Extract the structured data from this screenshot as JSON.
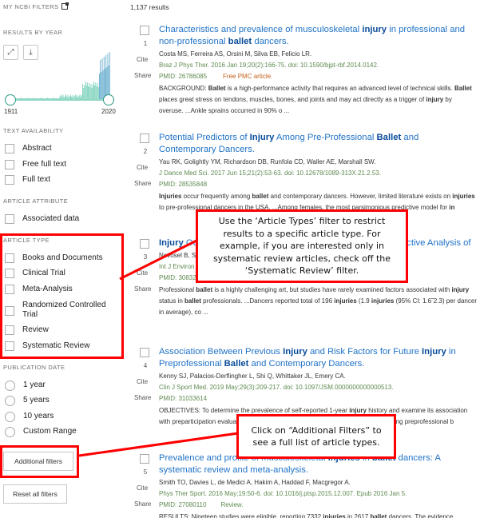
{
  "sidebar": {
    "my_ncbi_filters": "MY NCBI FILTERS",
    "my_ncbi_icon": "external-link-icon",
    "results_by_year": {
      "heading": "RESULTS BY YEAR",
      "expand_icon": "expand-icon",
      "download_icon": "download-icon",
      "year_start": "1911",
      "year_end": "2020",
      "bar_color": "#7fd3bd",
      "bar_color_recent": "#6aafd0"
    },
    "text_availability": {
      "heading": "TEXT AVAILABILITY",
      "items": [
        {
          "label": "Abstract",
          "checked": false
        },
        {
          "label": "Free full text",
          "checked": false
        },
        {
          "label": "Full text",
          "checked": false
        }
      ]
    },
    "article_attribute": {
      "heading": "ARTICLE ATTRIBUTE",
      "items": [
        {
          "label": "Associated data",
          "checked": false
        }
      ]
    },
    "article_type": {
      "heading": "ARTICLE TYPE",
      "items": [
        {
          "label": "Books and Documents",
          "checked": false
        },
        {
          "label": "Clinical Trial",
          "checked": false
        },
        {
          "label": "Meta-Analysis",
          "checked": false
        },
        {
          "label": "Randomized Controlled Trial",
          "checked": false
        },
        {
          "label": "Review",
          "checked": false
        },
        {
          "label": "Systematic Review",
          "checked": false
        }
      ]
    },
    "publication_date": {
      "heading": "PUBLICATION DATE",
      "items": [
        {
          "label": "1 year",
          "selected": false
        },
        {
          "label": "5 years",
          "selected": false
        },
        {
          "label": "10 years",
          "selected": false
        },
        {
          "label": "Custom Range",
          "selected": false
        }
      ]
    },
    "additional_filters_label": "Additional filters",
    "reset_filters_label": "Reset all filters"
  },
  "results": {
    "count": "1,137 results",
    "cite_label": "Cite",
    "share_label": "Share",
    "items": [
      {
        "number": "1",
        "title_html": "Characteristics and prevalence of musculoskeletal <b>injury</b> in professional and non-professional <b>ballet</b> dancers.",
        "authors": "Costa MS, Ferreira AS, Orsini M, Silva EB, Felicio LR.",
        "journal": "Braz J Phys Ther. 2016 Jan 19;20(2):166-75. doi: 10.1590/bjpt-rbf.2014.0142.",
        "pmid": "PMID: 26786085",
        "badge": "Free PMC article.",
        "snippet_html": "BACKGROUND: <b>Ballet</b> is a high-performance activity that requires an advanced level of technical skills. <b>Ballet</b> places great stress on tendons, muscles, bones, and joints and may act directly as a trigger of <b>injury</b> by overuse. ...Ankle sprains occurred in 90% o ..."
      },
      {
        "number": "2",
        "title_html": "Potential Predictors of <b>Injury</b> Among Pre-Professional <b>Ballet</b> and Contemporary Dancers.",
        "authors": "Yau RK, Golightly YM, Richardson DB, Runfola CD, Waller AE, Marshall SW.",
        "journal": "J Dance Med Sci. 2017 Jun 15;21(2):53-63. doi: 10.12678/1089-313X.21.2.53.",
        "pmid": "PMID: 28535848",
        "badge": "",
        "snippet_html": "<b>Injuries</b> occur frequently among <b>ballet</b> and contemporary dancers. However, limited literature exists on <b>injuries</b> to pre-professional dancers in the USA. ...Among females, the most parsimonious predictive model for <b>in</b>"
      },
      {
        "number": "3",
        "title_html": "<b>Injury</b> Occurrence in Professional <b>Ballet</b> Dancers: A Retrospective Analysis of",
        "authors": "Novosel B, S",
        "journal": "Int J Environ",
        "pmid": "PMID: 30832431",
        "badge": "Free PMC article.",
        "snippet_html": "Professional <b>ballet</b> is a highly challenging art, but studies have rarely examined factors associated with <b>injury</b> status in <b>ballet</b> professionals. ...Dancers reported total of 196 <b>injuries</b> (1.9 <b>injuries</b> (95% CI: 1.6˜2.3) per dancer in average), co ..."
      },
      {
        "number": "4",
        "title_html": "Association Between Previous <b>Injury</b> and Risk Factors for Future <b>Injury</b> in Preprofessional <b>Ballet</b> and Contemporary Dancers.",
        "authors": "Kenny SJ, Palacios-Derflingher L, Shi Q, Whittaker JL, Emery CA.",
        "journal": "Clin J Sport Med. 2019 May;29(3):209-217. doi: 10.1097/JSM.0000000000000513.",
        "pmid": "PMID: 31033614",
        "badge": "",
        "snippet_html": "OBJECTIVES: To determine the prevalence of self-reported 1-year <b>injury</b> history and examine its association with preparticipation evaluation injury prediction and future <b>injury</b> risk (PPE-IP) among preprofessional b"
      },
      {
        "number": "5",
        "title_html": "Prevalence and profile of musculoskeletal <b>injuries</b> in <b>ballet</b> dancers: A systematic review and meta-analysis.",
        "authors": "Smith TO, Davies L, de Medici A, Hakim A, Haddad F, Macgregor A.",
        "journal": "Phys Ther Sport. 2016 May;19:50-6. doi: 10.1016/j.ptsp.2015.12.007. Epub 2016 Jan 5.",
        "pmid": "PMID: 27080110",
        "badge": "",
        "type": "Review.",
        "snippet_html": "RESULTS: Nineteen studies were eligible, reporting 7332 <b>injuries</b> in 2617 <b>ballet</b> dancers. The evidence"
      }
    ]
  },
  "annotations": {
    "article_types_callout": "Use the ‘Article Types’ filter to restrict results to a specific article type. For example, if you are interested only in systematic review articles, check off the ‘Systematic Review’ filter.",
    "additional_filters_callout": "Click on “Additional Filters” to see a full list of article types.",
    "highlight_color": "#ff0000"
  }
}
